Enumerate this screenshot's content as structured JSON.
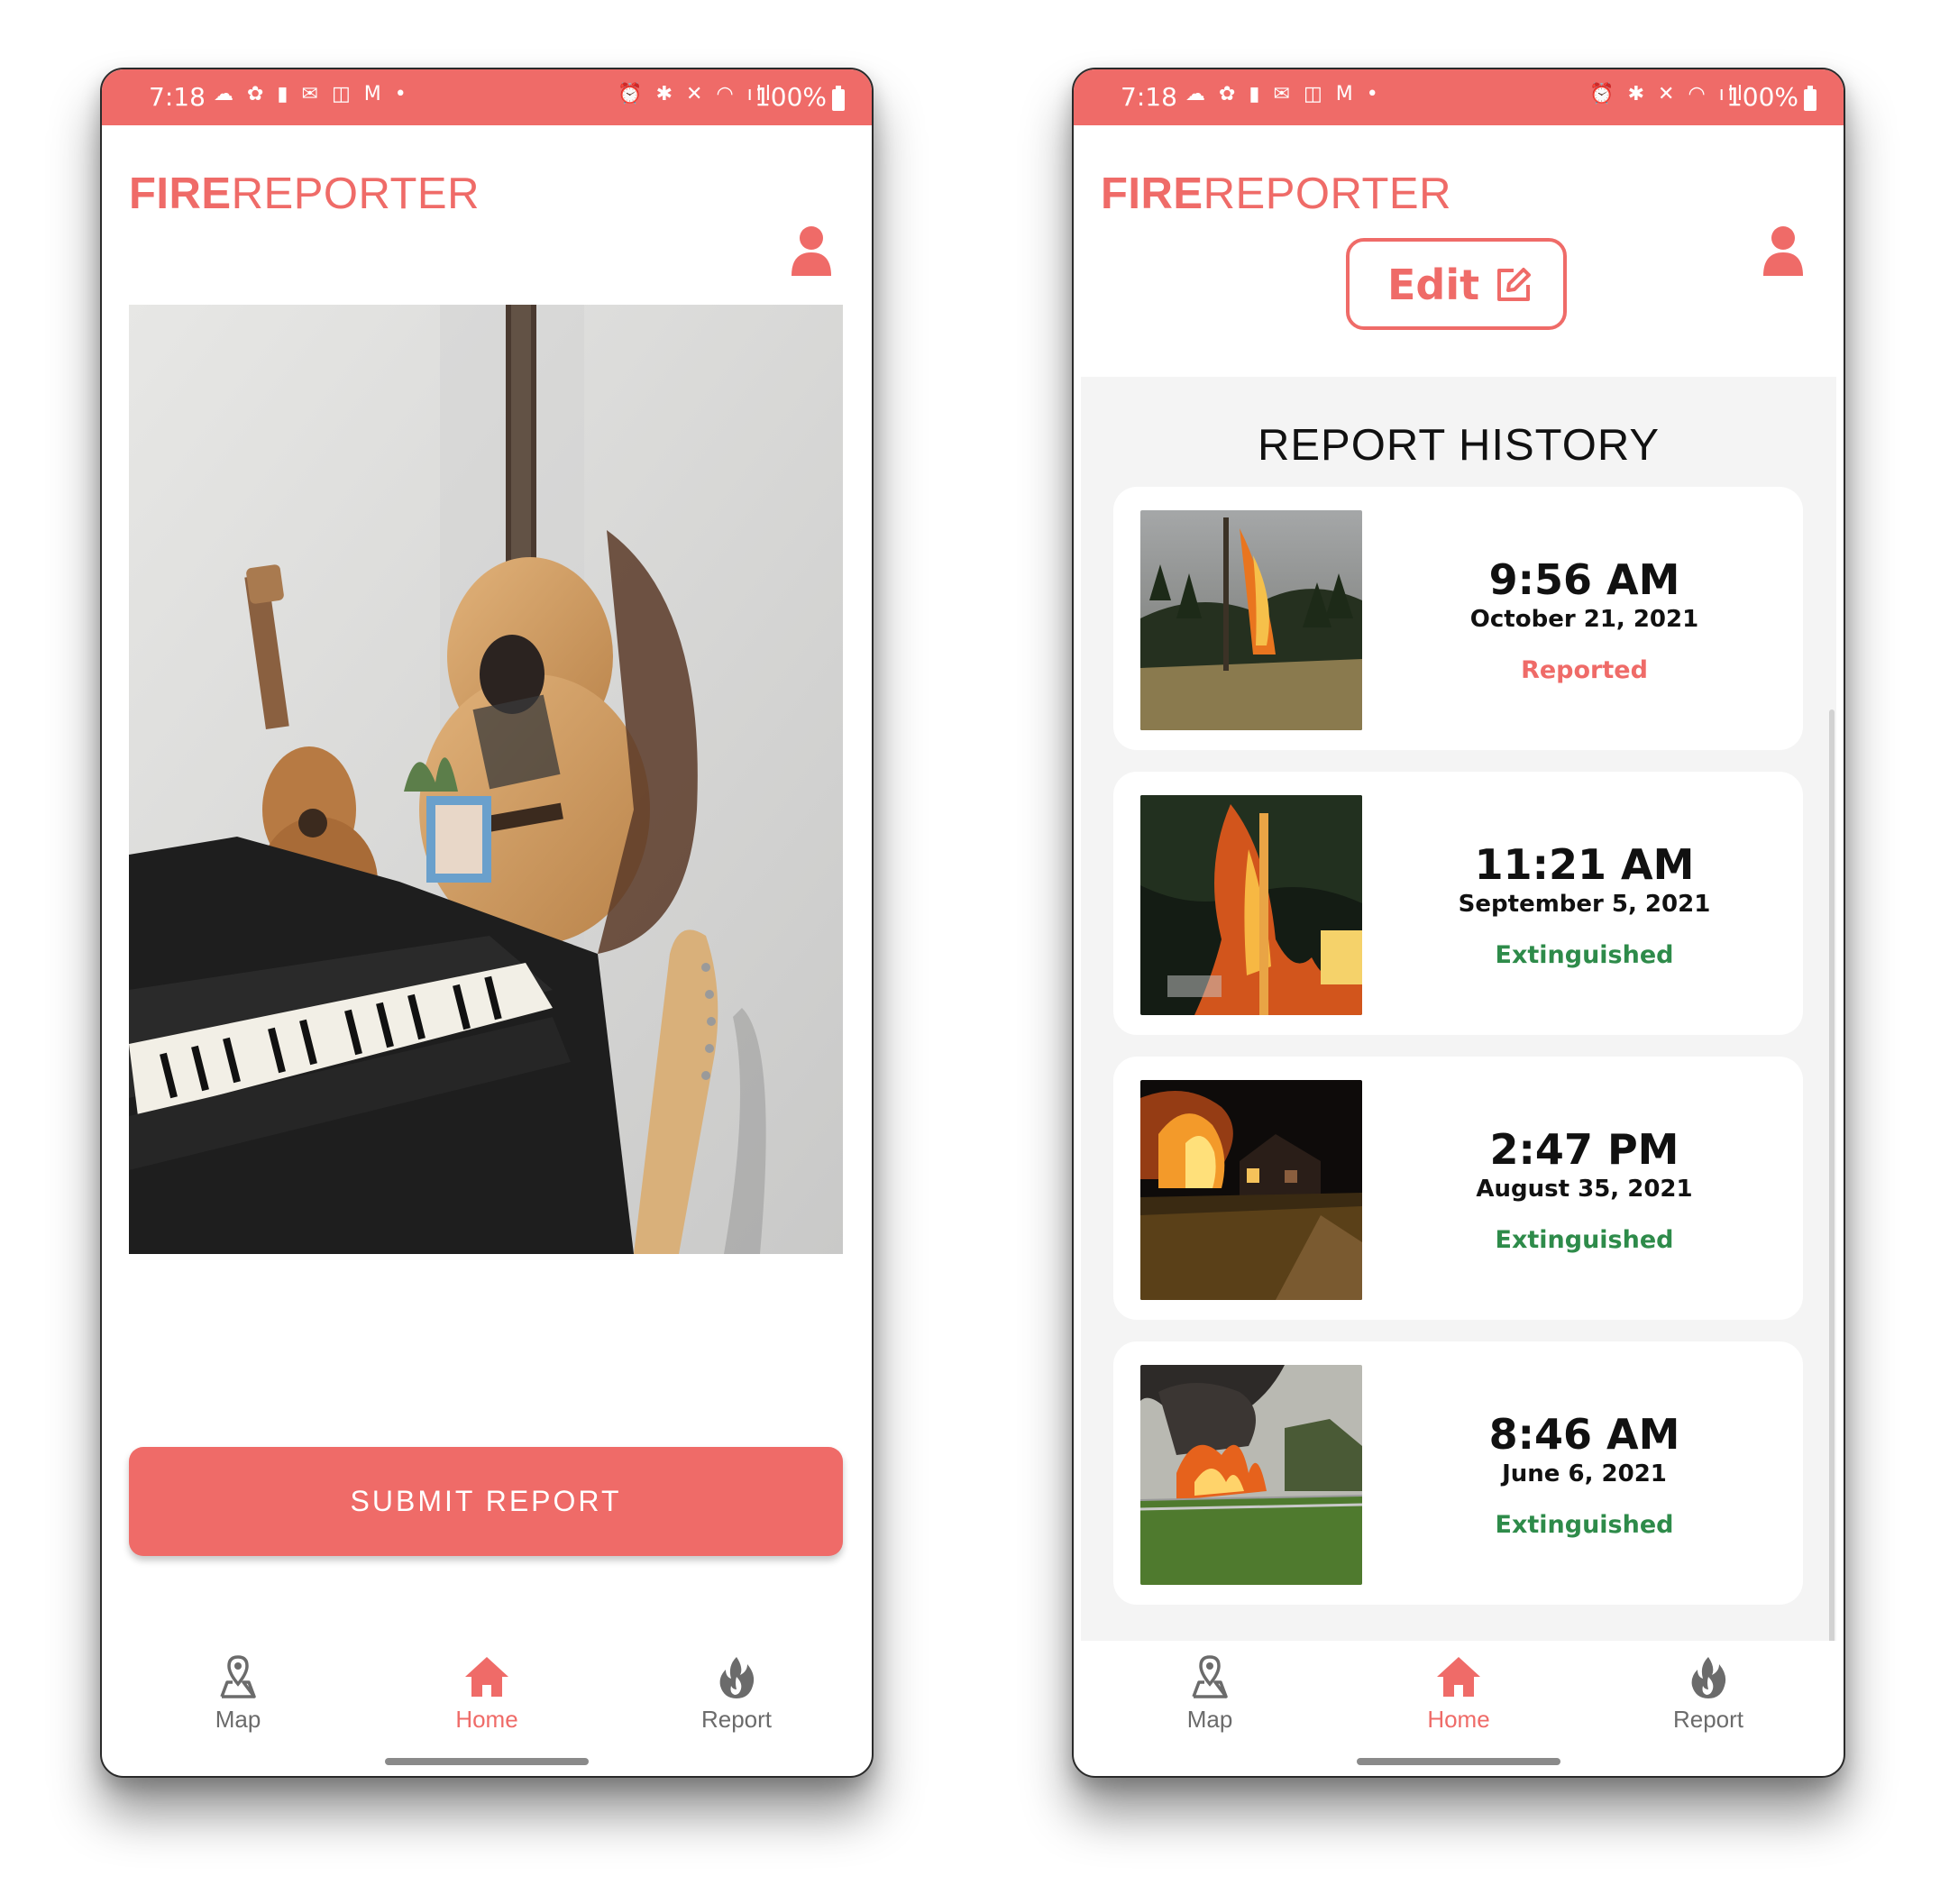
{
  "status_bar": {
    "time": "7:18",
    "battery": "100%",
    "left_icons": "☁ ✿ ▮ ✉ ◫ M •",
    "right_icons": "⏰ ✱ ✕ ◠ ıll"
  },
  "app": {
    "logo_bold": "FIRE",
    "logo_light": "REPORTER",
    "accent_color": "#ef6b68",
    "profile_icon": "user-icon"
  },
  "home_capture": {
    "submit_label": "SUBMIT REPORT"
  },
  "home_history": {
    "edit_label": "Edit",
    "edit_icon": "edit-icon",
    "title": "REPORT HISTORY",
    "reports": [
      {
        "time": "9:56 AM",
        "date": "October 21, 2021",
        "status": "Reported",
        "status_color": "#ef6b68"
      },
      {
        "time": "11:21 AM",
        "date": "September 5, 2021",
        "status": "Extinguished",
        "status_color": "#2e8b4a"
      },
      {
        "time": "2:47 PM",
        "date": "August 35, 2021",
        "status": "Extinguished",
        "status_color": "#2e8b4a"
      },
      {
        "time": "8:46 AM",
        "date": "June 6, 2021",
        "status": "Extinguished",
        "status_color": "#2e8b4a"
      }
    ]
  },
  "nav": {
    "map_label": "Map",
    "home_label": "Home",
    "report_label": "Report",
    "active": "Home",
    "icons": [
      "map-pin-icon",
      "home-icon",
      "fire-icon"
    ]
  }
}
